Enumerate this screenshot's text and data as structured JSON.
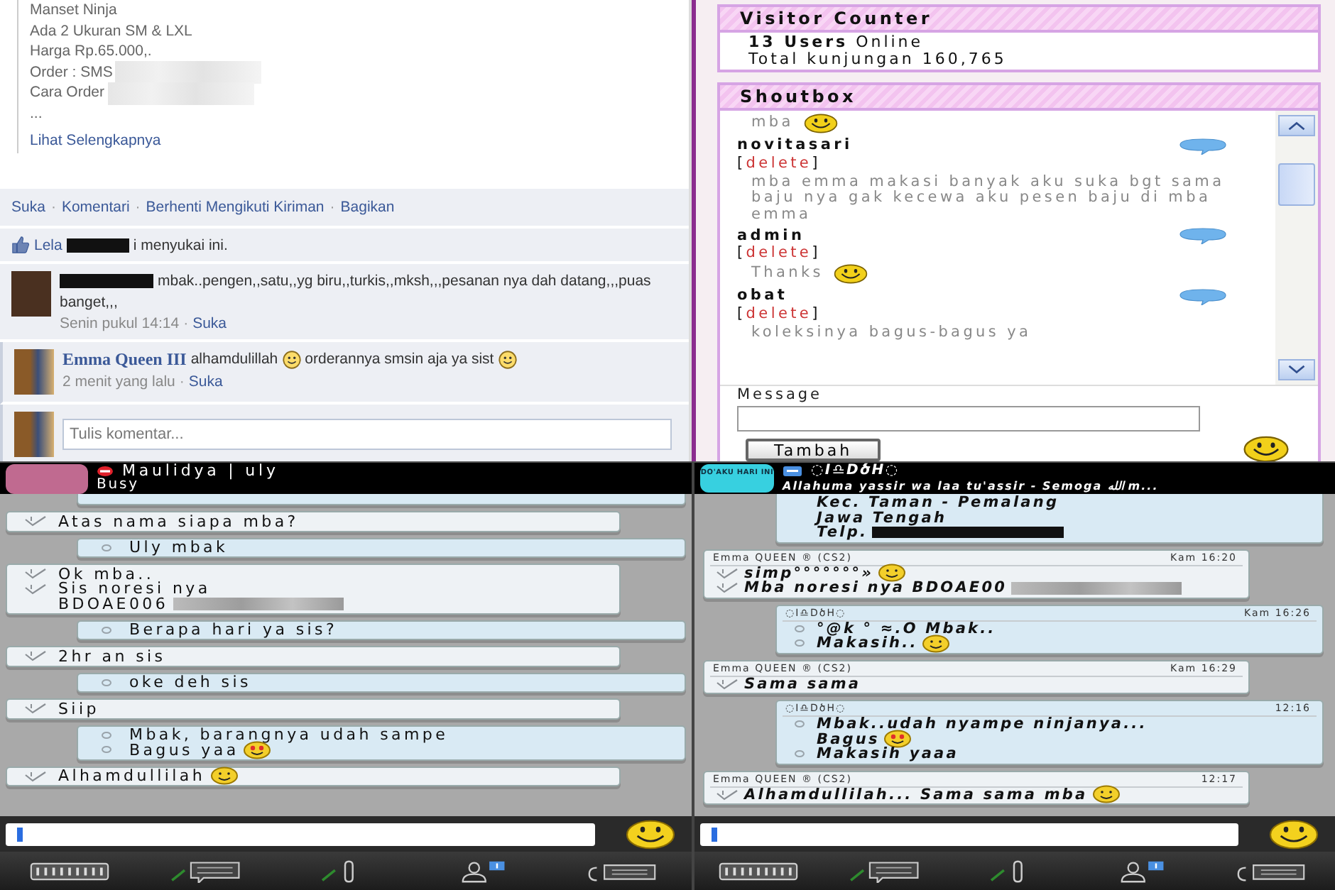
{
  "facebook_post": {
    "description_lines": [
      {
        "text": "Manset Ninja",
        "blurred": false
      },
      {
        "text": "Ada 2 Ukuran SM & LXL",
        "blurred": false
      },
      {
        "text": "Harga Rp.65.000,.",
        "blurred": false
      },
      {
        "text": "Order : SMS",
        "blurred": true
      },
      {
        "text": "Cara Order",
        "blurred": true
      },
      {
        "text": "...",
        "blurred": false
      }
    ],
    "see_more": "Lihat Selengkapnya",
    "separator": "·",
    "actions": [
      "Suka",
      "Komentari",
      "Berhenti Mengikuti Kiriman",
      "Bagikan"
    ],
    "likes": {
      "name": "Lela",
      "text": "i menyukai ini."
    },
    "comments": [
      {
        "author_hidden": true,
        "segments": [
          {
            "text": "mbak..pengen,,satu,,yg biru,,turkis,,mksh,,,pesanan nya dah datang,,,puas",
            "smiley": false
          },
          {
            "text": "banget,,,",
            "smiley": false
          }
        ],
        "time": "Senin pukul 14:14",
        "like": "Suka"
      },
      {
        "author_hidden": false,
        "author": "Emma Queen III",
        "segments": [
          {
            "text": "alhamdulillah",
            "smiley": true
          },
          {
            "text": "orderannya smsin aja ya sist",
            "smiley": true
          }
        ],
        "time": "2 menit yang lalu",
        "like": "Suka"
      }
    ],
    "comment_box": {
      "placeholder": "Tulis komentar..."
    }
  },
  "visitor_counter": {
    "title": "Visitor Counter",
    "count": "13 Users",
    "count_label": "Online",
    "total": "Total kunjungan 160,765"
  },
  "shoutbox": {
    "title": "Shoutbox",
    "entries": [
      {
        "kind": "text",
        "text": "mba",
        "smiley": true
      },
      {
        "kind": "name",
        "text": "novitasari"
      },
      {
        "kind": "delete",
        "open": "[",
        "text": "delete",
        "close": "]"
      },
      {
        "kind": "text",
        "text": "mba emma makasi banyak aku suka bgt sama baju nya gak kecewa aku pesen baju di mba emma",
        "smiley": false
      },
      {
        "kind": "name",
        "text": "admin"
      },
      {
        "kind": "delete",
        "open": "[",
        "text": "delete",
        "close": "]"
      },
      {
        "kind": "text",
        "text": "Thanks",
        "smiley": true
      },
      {
        "kind": "name",
        "text": "obat"
      },
      {
        "kind": "delete",
        "open": "[",
        "text": "delete",
        "close": "]"
      },
      {
        "kind": "text",
        "text": "koleksinya bagus-bagus ya",
        "smiley": false
      }
    ],
    "message_label": "Message",
    "button": "Tambah"
  },
  "bbm_chats": [
    {
      "header": {
        "busy": true,
        "name": "Maulidya | uly",
        "status": "Busy"
      },
      "messages": [
        {
          "outgoing": true,
          "partial": true
        },
        {
          "outgoing": false,
          "partial": false,
          "lines": [
            {
              "text": "Atas nama siapa mba?",
              "marker": true
            }
          ]
        },
        {
          "outgoing": true,
          "partial": false,
          "lines": [
            {
              "text": "Uly mbak",
              "marker": true
            }
          ]
        },
        {
          "outgoing": false,
          "partial": false,
          "lines": [
            {
              "text": "Ok mba..",
              "marker": true
            },
            {
              "text": "Sis noresi nya",
              "marker": true
            },
            {
              "text": "BDOAE006",
              "marker": false,
              "blurred": true
            }
          ]
        },
        {
          "outgoing": true,
          "partial": false,
          "lines": [
            {
              "text": "Berapa hari ya sis?",
              "marker": true
            }
          ]
        },
        {
          "outgoing": false,
          "partial": false,
          "lines": [
            {
              "text": "2hr an sis",
              "marker": true
            }
          ]
        },
        {
          "outgoing": true,
          "partial": false,
          "lines": [
            {
              "text": "oke deh sis",
              "marker": true
            }
          ]
        },
        {
          "outgoing": false,
          "partial": false,
          "lines": [
            {
              "text": "Siip",
              "marker": true
            }
          ]
        },
        {
          "outgoing": true,
          "partial": false,
          "lines": [
            {
              "text": "Mbak, barangnya udah sampe",
              "marker": true
            },
            {
              "text": "Bagus yaa",
              "marker": true,
              "hearts": true
            }
          ]
        },
        {
          "outgoing": false,
          "partial": false,
          "lines": [
            {
              "text": "Alhamdullilah",
              "marker": true,
              "smiley": true
            }
          ]
        }
      ]
    },
    {
      "header": {
        "busy": false,
        "badge_text": "DO'AKU HARI INI",
        "name": "◌I♎DծH◌",
        "status": "Allahuma yassir wa laa tu'assir - Semoga الله m..."
      },
      "messages": [
        {
          "outgoing": true,
          "partial": true,
          "lines": [
            {
              "text": "Kec. Taman - Pemalang",
              "marker": false
            },
            {
              "text": "Jawa Tengah",
              "marker": false
            },
            {
              "text": "Telp.",
              "marker": false,
              "redacted": true
            }
          ]
        },
        {
          "outgoing": false,
          "partial": false,
          "sender": "Emma QUEEN ® (CS2)",
          "time": "Kam 16:20",
          "lines": [
            {
              "text": "simp°°°°°°°»",
              "marker": true,
              "smiley": true
            },
            {
              "text": "Mba noresi nya BDOAE00",
              "marker": true,
              "blurred": true
            }
          ]
        },
        {
          "outgoing": true,
          "partial": false,
          "sender": "◌I♎DծH◌",
          "time": "Kam 16:26",
          "lines": [
            {
              "text": "°@k ° ≈.Ο Mbak..",
              "marker": true
            },
            {
              "text": "Makasih..",
              "marker": true,
              "smiley": true
            }
          ]
        },
        {
          "outgoing": false,
          "partial": false,
          "sender": "Emma QUEEN ® (CS2)",
          "time": "Kam 16:29",
          "lines": [
            {
              "text": "Sama sama",
              "marker": true
            }
          ]
        },
        {
          "outgoing": true,
          "partial": false,
          "sender": "◌I♎DծH◌",
          "time": "12:16",
          "lines": [
            {
              "text": "Mbak..udah nyampe ninjanya...",
              "marker": true
            },
            {
              "text": "Bagus",
              "marker": false,
              "hearts": true
            },
            {
              "text": "Makasih yaaa",
              "marker": true
            }
          ]
        },
        {
          "outgoing": false,
          "partial": false,
          "sender": "Emma QUEEN ® (CS2)",
          "time": "12:17",
          "lines": [
            {
              "text": "Alhamdullilah... Sama sama mba",
              "marker": true,
              "smiley": true
            }
          ]
        }
      ]
    }
  ]
}
